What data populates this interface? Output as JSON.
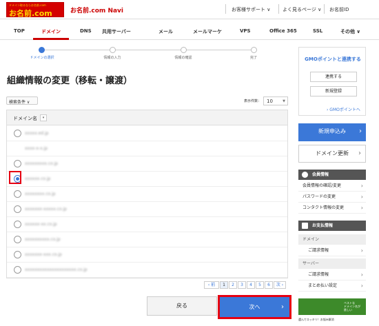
{
  "header": {
    "logo_small": "ドメイン取るならお名前.com",
    "logo_big": "お名前.com",
    "title": "お名前.com Navi",
    "links": [
      "お客様サポート ∨",
      "よく見るページ ∨",
      "お名前ID"
    ]
  },
  "nav": {
    "items": [
      "TOP",
      "ドメイン",
      "DNS",
      "共用サーバー",
      "メール",
      "メールマーケ",
      "VPS",
      "Office 365",
      "SSL",
      "その他 ∨"
    ],
    "active_index": 1
  },
  "steps": {
    "labels": [
      "ドメインの選択",
      "情報の入力",
      "情報の確認",
      "完了"
    ],
    "active_index": 0
  },
  "page": {
    "title": "組織情報の変更（移転・譲渡）",
    "search_label": "検索条件 ∨",
    "per_page_label": "表示件数：",
    "per_page_value": "10"
  },
  "table": {
    "header": "ドメイン名",
    "sort_icon": "▾",
    "rows": [
      {
        "domain": "xxxxx.ed.jp",
        "has_radio": true,
        "checked": false
      },
      {
        "domain": "xxxx-x-x.jp",
        "has_radio": false,
        "checked": false
      },
      {
        "domain": "xxxxxxxxx.co.jp",
        "has_radio": true,
        "checked": false
      },
      {
        "domain": "xxxxxx.co.jp",
        "has_radio": true,
        "checked": true
      },
      {
        "domain": "xxxxxxxx.co.jp",
        "has_radio": true,
        "checked": false
      },
      {
        "domain": "xxxxxxx-xxxxx.co.jp",
        "has_radio": true,
        "checked": false
      },
      {
        "domain": "xxxxxx-xx.co.jp",
        "has_radio": true,
        "checked": false
      },
      {
        "domain": "xxxxxxxxxx.co.jp",
        "has_radio": true,
        "checked": false
      },
      {
        "domain": "xxxxxxx-xxx.co.jp",
        "has_radio": true,
        "checked": false
      },
      {
        "domain": "xxxxxxxxxxxxxxxxxxxxx.co.jp",
        "has_radio": true,
        "checked": false
      }
    ]
  },
  "pagination": {
    "prev": "‹ 前",
    "pages": [
      "1",
      "2",
      "3",
      "4",
      "5",
      "6"
    ],
    "current": "1",
    "next": "次 ›"
  },
  "buttons": {
    "back": "戻る",
    "next": "次へ"
  },
  "sidebar": {
    "gmo_title": "GMOポイントと連携する",
    "link_btn": "連携する",
    "register_btn": "新規登録",
    "gmo_link": "› GMOポイントへ",
    "new_apply": "新規申込み",
    "renew": "ドメイン更新",
    "member_title": "会員情報",
    "member_items": [
      "会員情報の確認/変更",
      "パスワードの変更",
      "コンタクト情報の変更"
    ],
    "payment_title": "お支払情報",
    "domain_sub": "ドメイン",
    "domain_items": [
      "ご請求情報"
    ],
    "server_sub": "サーバー",
    "server_items": [
      "ご請求情報",
      "まとめ払い設定"
    ],
    "banner_text": "ベストな\nドメイン名が\n欲しい",
    "banner_caption": "選んでスッキリ！お悩み解消"
  },
  "colors": {
    "brand_red": "#d40000",
    "accent_blue": "#3b78d8",
    "highlight_red": "#e60012"
  }
}
